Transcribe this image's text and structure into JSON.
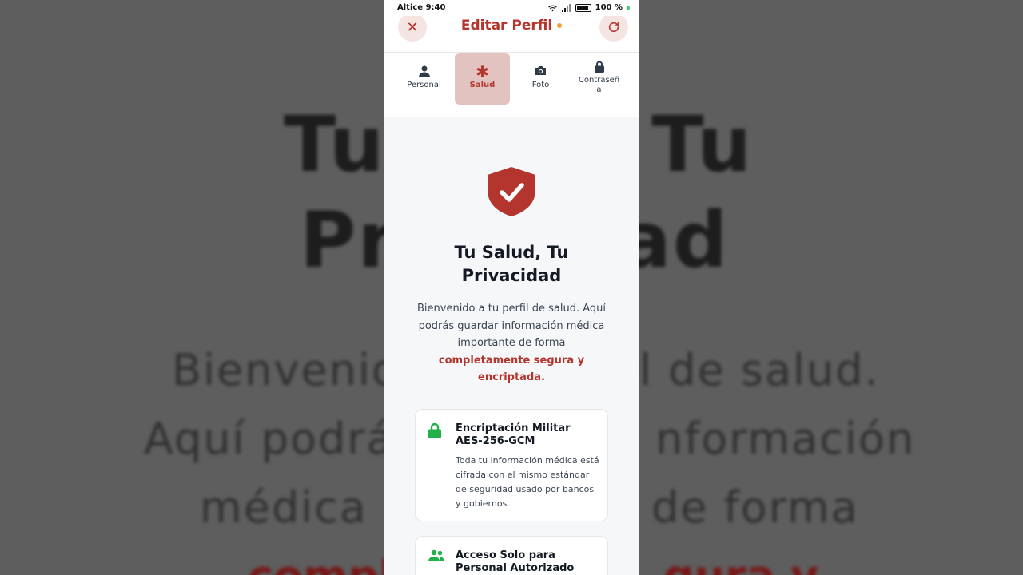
{
  "status_bar": {
    "carrier": "Altice",
    "time": "9:40",
    "battery": "100 %"
  },
  "header": {
    "title": "Editar Perfil",
    "close_icon": "close-icon",
    "refresh_icon": "refresh-icon"
  },
  "tabs": [
    {
      "label": "Personal",
      "icon": "person-icon",
      "active": false
    },
    {
      "label": "Salud",
      "icon": "asterisk-icon",
      "active": true
    },
    {
      "label": "Foto",
      "icon": "camera-icon",
      "active": false
    },
    {
      "label": "Contraseña",
      "label_line1": "Contraseñ",
      "label_line2": "a",
      "icon": "lock-icon",
      "active": false
    }
  ],
  "main": {
    "title_line1": "Tu Salud, Tu",
    "title_line2": "Privacidad",
    "description": "Bienvenido a tu perfil de salud. Aquí podrás guardar información médica importante de forma",
    "highlight": "completamente segura y encriptada."
  },
  "cards": [
    {
      "icon": "lock-icon",
      "title": "Encriptación Militar AES-256-GCM",
      "body": "Toda tu información médica está cifrada con el mismo estándar de seguridad usado por bancos y gobiernos."
    },
    {
      "icon": "users-icon",
      "title": "Acceso Solo para Personal Autorizado",
      "body": ""
    }
  ],
  "background_overlay": {
    "title_a": "Tu",
    "title_b": "Tu",
    "title_c": "Pr",
    "title_d": "ad",
    "line1_a": "Bienvenid",
    "line1_b": "l de salud.",
    "line2_a": "Aquí podrá",
    "line2_b": "nformación",
    "line3_a": "médica i",
    "line3_b": "de forma",
    "line4_a": "comple",
    "line4_b": "gura y"
  },
  "colors": {
    "accent": "#b3352d",
    "success": "#22b04b",
    "tab_active_bg": "#e3c3c0"
  }
}
